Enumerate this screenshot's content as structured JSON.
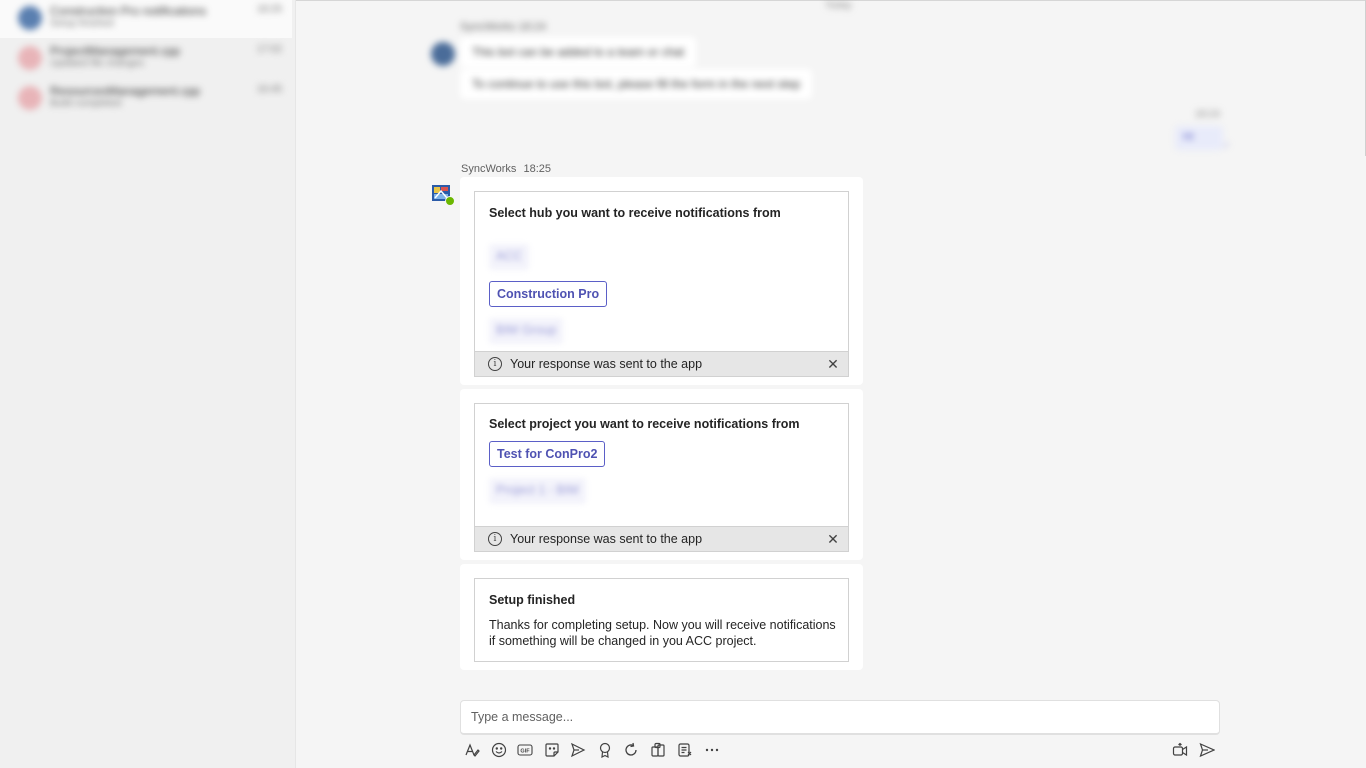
{
  "sidebar": {
    "chats": [
      {
        "title": "Construction Pro notifications",
        "preview": "Setup finished",
        "time": "18:25"
      },
      {
        "title": "ProjectManagement.cpp",
        "preview": "Updated file changes",
        "time": "17:02"
      },
      {
        "title": "ResourcesManagement.cpp",
        "preview": "Build completed",
        "time": "16:45"
      }
    ]
  },
  "history": {
    "divider_time": "Today",
    "sender": "SyncWorks",
    "sender_time": "18:24",
    "messages": [
      "This bot can be added to a team or chat",
      "To continue to use this bot, please fill the form in the next step"
    ],
    "own_time": "18:24",
    "own_message": "Hi"
  },
  "bot": {
    "name": "SyncWorks",
    "time": "18:25"
  },
  "cards": {
    "hub": {
      "title": "Select hub you want to receive notifications from",
      "options": [
        "ACC",
        "Construction Pro",
        "BIM Group"
      ],
      "selected_index": 1,
      "status": "Your response was sent to the app"
    },
    "project": {
      "title": "Select project you want to receive notifications from",
      "options": [
        "Test for ConPro2",
        "Project 1 - BIM"
      ],
      "selected_index": 0,
      "status": "Your response was sent to the app"
    },
    "setup": {
      "title": "Setup finished",
      "body": "Thanks for completing setup. Now you will receive notifications if something will be changed in you ACC project."
    }
  },
  "compose": {
    "placeholder": "Type a message..."
  },
  "toolbar": {
    "left_icons": [
      "format-icon",
      "emoji-icon",
      "gif-icon",
      "sticker-icon",
      "schedule-icon",
      "praise-icon",
      "loop-icon",
      "apps-icon",
      "stream-icon",
      "more-icon"
    ],
    "right_icons": [
      "video-clip-icon",
      "send-icon"
    ]
  },
  "colors": {
    "accent": "#5b5fc7",
    "background": "#f5f5f5",
    "presence": "#6bb700"
  }
}
